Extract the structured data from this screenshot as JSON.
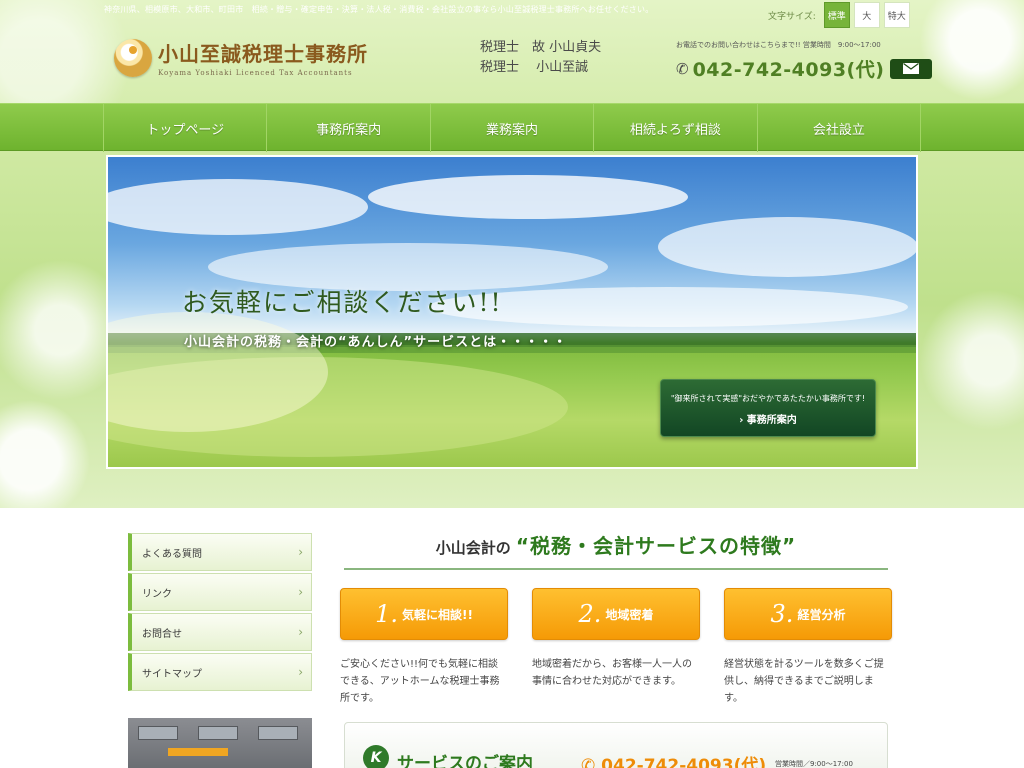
{
  "top_note": "神奈川県、相模原市、大和市、町田市　相続・贈与・確定申告・決算・法人税・消費税・会社設立の事なら小山至誠税理士事務所へお任せください。",
  "font_size": {
    "label": "文字サイズ:",
    "options": [
      "標準",
      "大",
      "特大"
    ],
    "selected": "標準"
  },
  "logo": {
    "title": "小山至誠税理士事務所",
    "subtitle": "Koyama Yoshiaki Licenced Tax Accountants"
  },
  "staff": {
    "line1": "税理士　故 小山貞夫",
    "line2": "税理士　 小山至誠"
  },
  "contact": {
    "note": "お電話でのお問い合わせはこちらまで!! 営業時間　9:00～17:00",
    "phone": "042-742-4093(代)",
    "phone_icon": "phone-icon",
    "mail_icon": "mail-icon"
  },
  "nav": {
    "items": [
      "トップページ",
      "事務所案内",
      "業務案内",
      "相続よろず相談",
      "会社設立"
    ]
  },
  "hero": {
    "title": "お気軽にご相談ください!!",
    "subtitle": "小山会計の税務・会計の“あんしん”サービスとは・・・・・",
    "box_text": "\"御来所されて実感\"おだやかであたたかい事務所です!",
    "box_link": "事務所案内"
  },
  "sidebar": {
    "items": [
      "よくある質問",
      "リンク",
      "お問合せ",
      "サイトマップ"
    ]
  },
  "section": {
    "prefix": "小山会計の",
    "title": "“税務・会計サービスの特徴”"
  },
  "features": [
    {
      "num": "1.",
      "label": "気軽に相談!!",
      "text": "ご安心ください!!何でも気軽に相談できる、アットホームな税理士事務所です。"
    },
    {
      "num": "2.",
      "label": "地域密着",
      "text": "地域密着だから、お客様一人一人の事情に合わせた対応ができます。"
    },
    {
      "num": "3.",
      "label": "経営分析",
      "text": "経営状態を計るツールを数多くご提供し、納得できるまでご説明します。"
    }
  ],
  "service": {
    "title": "サービスのご案内",
    "phone": "042-742-4093(代)",
    "hours": "営業時間／9:00～17:00"
  },
  "colors": {
    "nav_green": "#6eb32e",
    "accent_orange": "#f59a06",
    "heading_green": "#2e7a1e"
  }
}
